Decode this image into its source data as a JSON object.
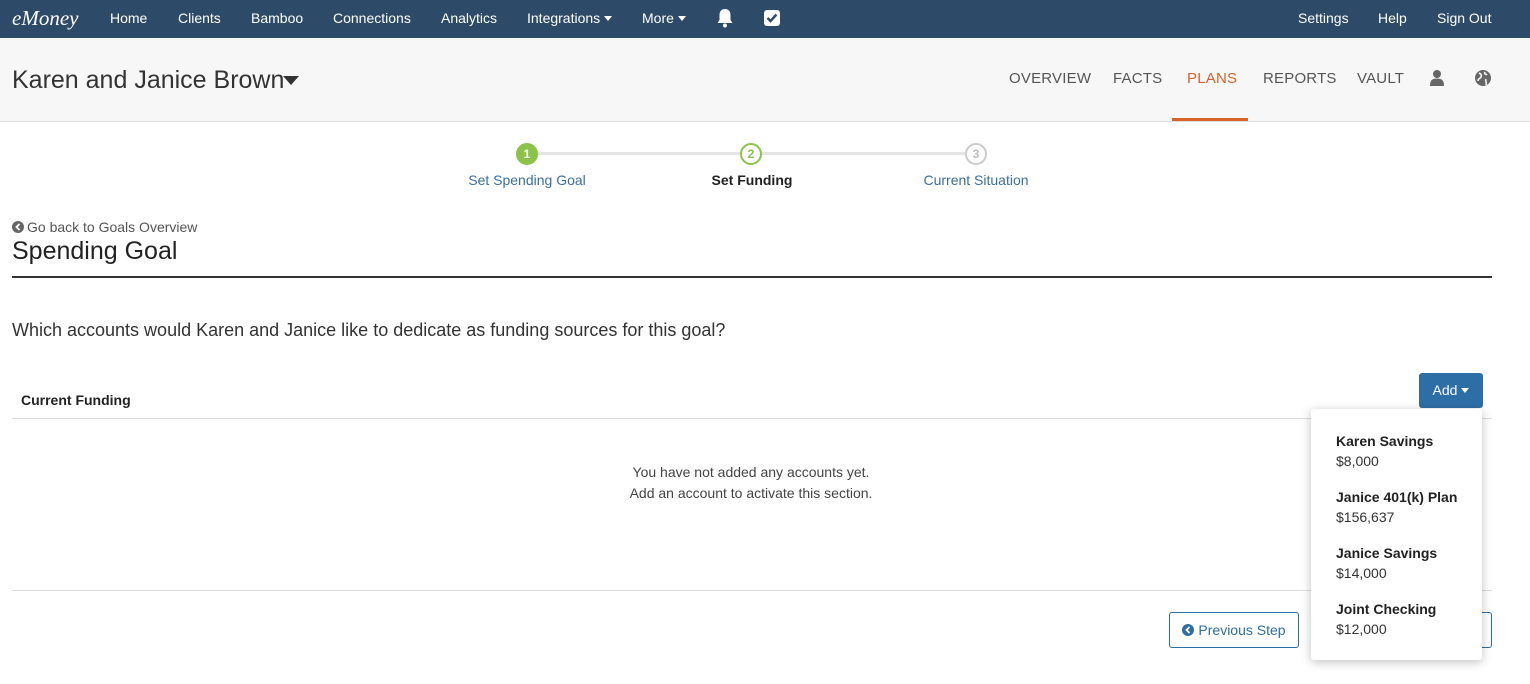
{
  "topnav": {
    "logo": "eMoney",
    "items": [
      "Home",
      "Clients",
      "Bamboo",
      "Connections",
      "Analytics",
      "Integrations",
      "More"
    ],
    "right_items": [
      "Settings",
      "Help",
      "Sign Out"
    ],
    "icons": [
      "bell-icon",
      "checkbox-icon"
    ]
  },
  "client": {
    "name": "Karen and Janice Brown",
    "tabs": [
      "OVERVIEW",
      "FACTS",
      "PLANS",
      "REPORTS",
      "VAULT"
    ],
    "active_tab": "PLANS",
    "icons": [
      "user-icon",
      "globe-icon"
    ]
  },
  "stepper": {
    "steps": [
      {
        "number": "1",
        "label": "Set Spending Goal",
        "state": "done"
      },
      {
        "number": "2",
        "label": "Set Funding",
        "state": "current"
      },
      {
        "number": "3",
        "label": "Current Situation",
        "state": "future"
      }
    ]
  },
  "main": {
    "back_link": "Go back to Goals Overview",
    "title": "Spending Goal",
    "question": "Which accounts would Karen and Janice like to dedicate as funding sources for this goal?",
    "funding_header": "Current Funding",
    "empty_line1": "You have not added any accounts yet.",
    "empty_line2": "Add an account to activate this section.",
    "add_label": "Add",
    "prev_label": "Previous Step"
  },
  "dropdown": {
    "items": [
      {
        "name": "Karen Savings",
        "value": "$8,000"
      },
      {
        "name": "Janice 401(k) Plan",
        "value": "$156,637"
      },
      {
        "name": "Janice Savings",
        "value": "$14,000"
      },
      {
        "name": "Joint Checking",
        "value": "$12,000"
      }
    ]
  },
  "colors": {
    "nav_bg": "#2d4b68",
    "accent_orange": "#d9622b",
    "step_green": "#8bc34a",
    "primary_blue": "#2e6ea6"
  }
}
